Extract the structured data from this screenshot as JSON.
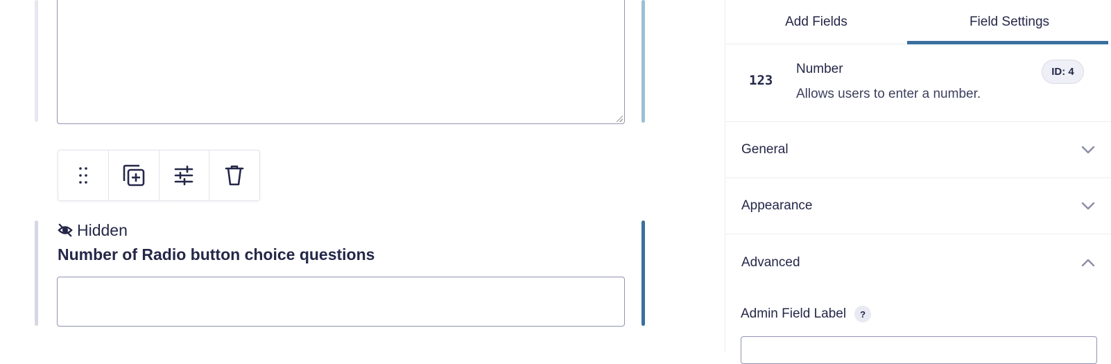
{
  "canvas": {
    "hidden_flag_label": "Hidden",
    "field_label": "Number of Radio button choice questions",
    "field_value": "",
    "toolbar": {
      "items": [
        {
          "name": "drag-handle-icon"
        },
        {
          "name": "duplicate-icon"
        },
        {
          "name": "settings-sliders-icon"
        },
        {
          "name": "trash-icon"
        }
      ]
    }
  },
  "sidebar": {
    "tabs": [
      {
        "label": "Add Fields",
        "active": false
      },
      {
        "label": "Field Settings",
        "active": true
      }
    ],
    "field": {
      "icon_text": "123",
      "name": "Number",
      "description": "Allows users to enter a number.",
      "id_badge": "ID: 4"
    },
    "sections": [
      {
        "label": "General",
        "expanded": false
      },
      {
        "label": "Appearance",
        "expanded": false
      },
      {
        "label": "Advanced",
        "expanded": true
      }
    ],
    "advanced": {
      "admin_field_label": "Admin Field Label",
      "help_glyph": "?",
      "admin_field_value": ""
    }
  },
  "colors": {
    "text": "#242748",
    "accent": "#3a6f9f",
    "border": "#9092b2",
    "divider": "#ecedf4"
  }
}
